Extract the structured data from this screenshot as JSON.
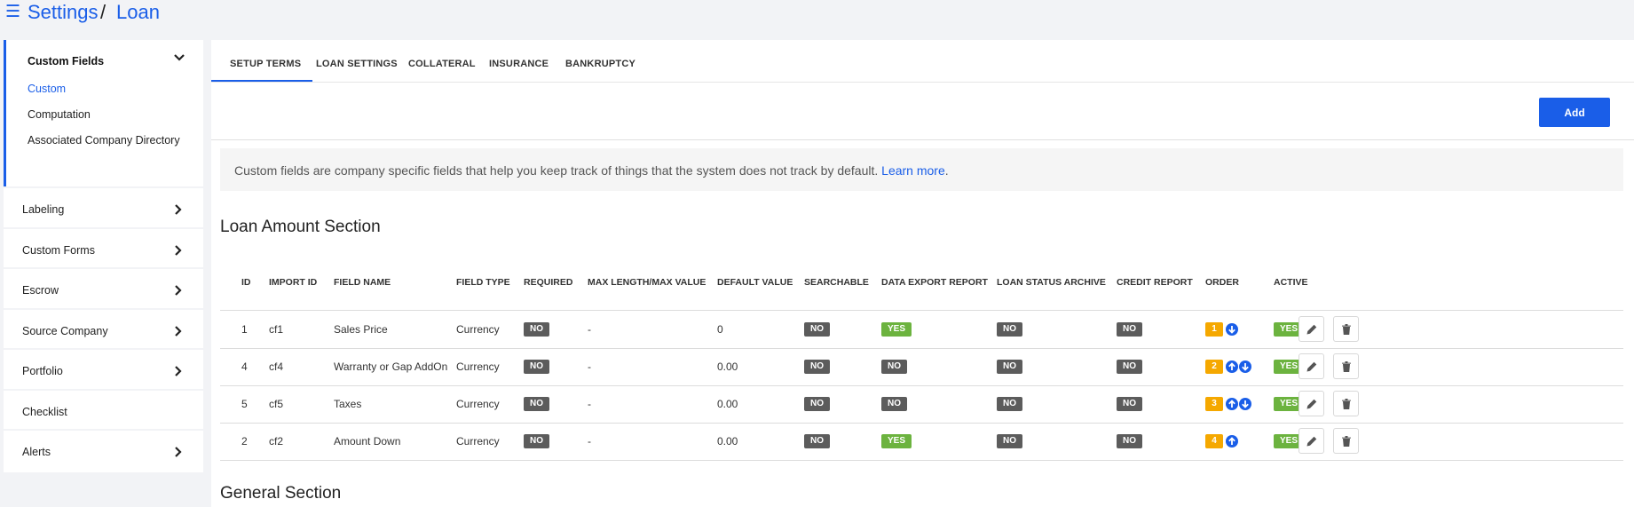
{
  "breadcrumb": {
    "root": "Settings",
    "separator": "/",
    "current": "Loan"
  },
  "sidebar": {
    "open_group": {
      "title": "Custom Fields",
      "items": [
        "Custom",
        "Computation",
        "Associated Company Directory"
      ],
      "active_item": "Custom"
    },
    "items": [
      {
        "label": "Labeling",
        "has_chevron": true
      },
      {
        "label": "Custom Forms",
        "has_chevron": true
      },
      {
        "label": "Escrow",
        "has_chevron": true
      },
      {
        "label": "Source Company",
        "has_chevron": true
      },
      {
        "label": "Portfolio",
        "has_chevron": true
      },
      {
        "label": "Checklist",
        "has_chevron": false
      },
      {
        "label": "Alerts",
        "has_chevron": true
      }
    ]
  },
  "tabs": [
    "SETUP TERMS",
    "LOAN SETTINGS",
    "COLLATERAL",
    "INSURANCE",
    "BANKRUPTCY"
  ],
  "active_tab": "SETUP TERMS",
  "add_button": "Add",
  "info": {
    "text": "Custom fields are company specific fields that help you keep track of things that the system does not track by default.",
    "link": "Learn more",
    "end": "."
  },
  "sections": {
    "loan_amount": "Loan Amount Section",
    "general": "General Section"
  },
  "table": {
    "columns": [
      "ID",
      "IMPORT ID",
      "FIELD NAME",
      "FIELD TYPE",
      "REQUIRED",
      "MAX LENGTH/MAX VALUE",
      "DEFAULT VALUE",
      "SEARCHABLE",
      "DATA EXPORT REPORT",
      "LOAN STATUS ARCHIVE",
      "CREDIT REPORT",
      "ORDER",
      "ACTIVE"
    ],
    "rows": [
      {
        "id": "1",
        "import_id": "cf1",
        "field_name": "Sales Price",
        "field_type": "Currency",
        "required": "NO",
        "max": "-",
        "default": "0",
        "searchable": "NO",
        "data_export": "YES",
        "loan_status_archive": "NO",
        "credit_report": "NO",
        "order": "1",
        "order_arrows": [
          "down"
        ],
        "active": "YES"
      },
      {
        "id": "4",
        "import_id": "cf4",
        "field_name": "Warranty or Gap AddOn",
        "field_type": "Currency",
        "required": "NO",
        "max": "-",
        "default": "0.00",
        "searchable": "NO",
        "data_export": "NO",
        "loan_status_archive": "NO",
        "credit_report": "NO",
        "order": "2",
        "order_arrows": [
          "up",
          "down"
        ],
        "active": "YES"
      },
      {
        "id": "5",
        "import_id": "cf5",
        "field_name": "Taxes",
        "field_type": "Currency",
        "required": "NO",
        "max": "-",
        "default": "0.00",
        "searchable": "NO",
        "data_export": "NO",
        "loan_status_archive": "NO",
        "credit_report": "NO",
        "order": "3",
        "order_arrows": [
          "up",
          "down"
        ],
        "active": "YES"
      },
      {
        "id": "2",
        "import_id": "cf2",
        "field_name": "Amount Down",
        "field_type": "Currency",
        "required": "NO",
        "max": "-",
        "default": "0.00",
        "searchable": "NO",
        "data_export": "YES",
        "loan_status_archive": "NO",
        "credit_report": "NO",
        "order": "4",
        "order_arrows": [
          "up"
        ],
        "active": "YES"
      }
    ]
  },
  "row_actions": [
    "pencil-icon",
    "trash-icon"
  ],
  "colors": {
    "accent": "#1a5ee8",
    "yes": "#6cb33f",
    "no": "#5c5c5c",
    "order": "#f5a800"
  }
}
